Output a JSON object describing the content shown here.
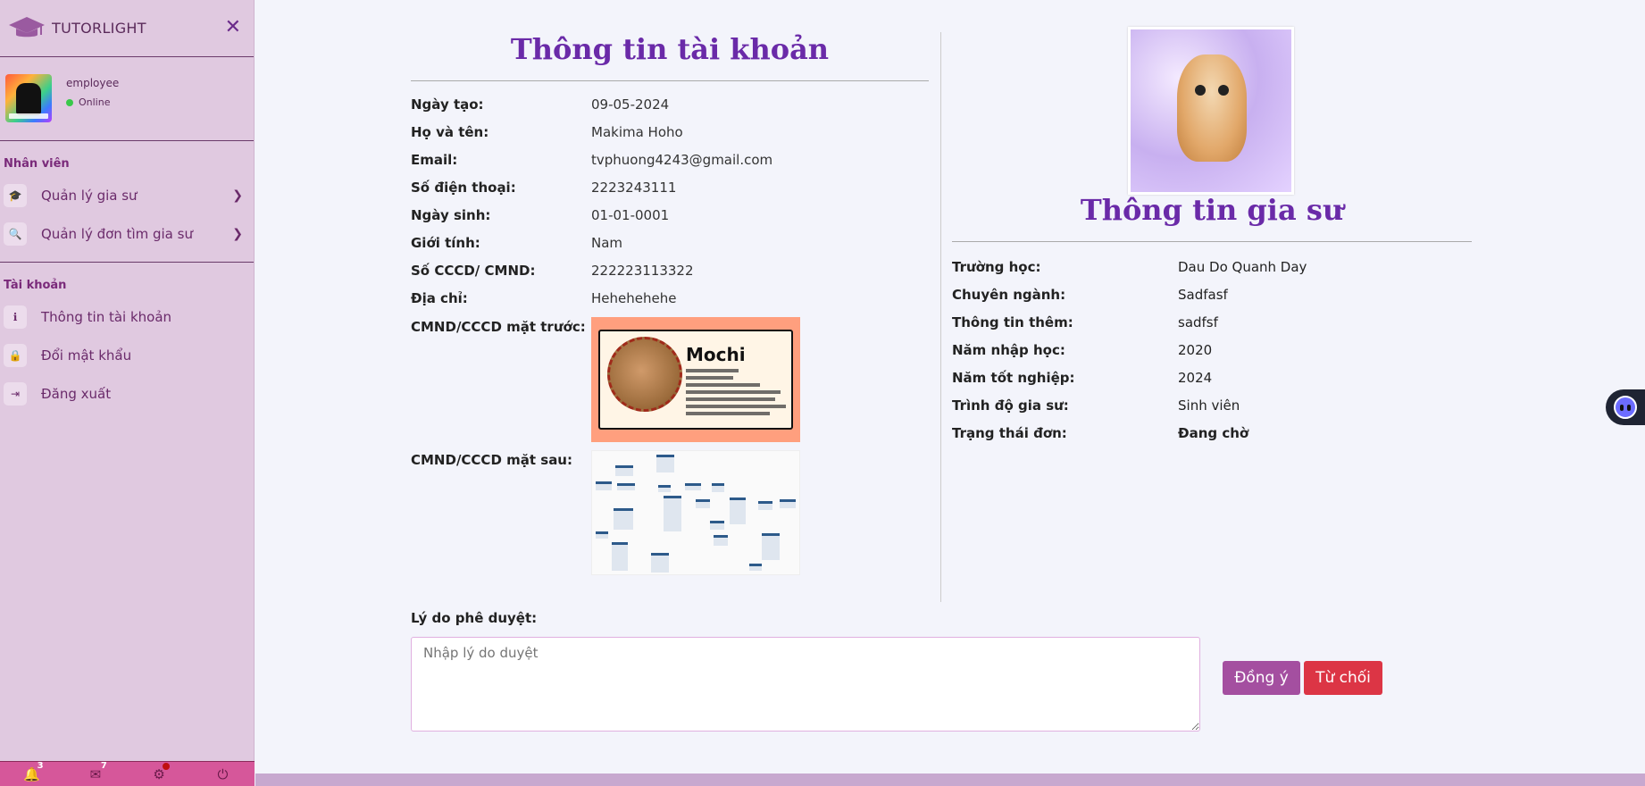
{
  "sidebar": {
    "brand": "TUTORLIGHT",
    "close_icon": "close-icon",
    "user": {
      "name": "employee",
      "status": "Online"
    },
    "sections": [
      {
        "title": "Nhân viên",
        "items": [
          {
            "label": "Quản lý gia sư",
            "icon": "graduation-cap-icon",
            "has_chevron": true
          },
          {
            "label": "Quản lý đơn tìm gia sư",
            "icon": "search-icon",
            "has_chevron": true
          }
        ]
      },
      {
        "title": "Tài khoản",
        "items": [
          {
            "label": "Thông tin tài khoản",
            "icon": "info-icon"
          },
          {
            "label": "Đổi mật khẩu",
            "icon": "lock-icon"
          },
          {
            "label": "Đăng xuất",
            "icon": "logout-icon"
          }
        ]
      }
    ],
    "footer": {
      "notifications": "3",
      "messages": "7"
    }
  },
  "account": {
    "title": "Thông tin tài khoản",
    "fields": [
      {
        "label": "Ngày tạo:",
        "value": "09-05-2024"
      },
      {
        "label": "Họ và tên:",
        "value": "Makima Hoho"
      },
      {
        "label": "Email:",
        "value": "tvphuong4243@gmail.com"
      },
      {
        "label": "Số điện thoại:",
        "value": "2223243111"
      },
      {
        "label": "Ngày sinh:",
        "value": "01-01-0001"
      },
      {
        "label": "Giới tính:",
        "value": "Nam"
      },
      {
        "label": "Số CCCD/ CMND:",
        "value": "222223113322"
      },
      {
        "label": "Địa chỉ:",
        "value": "Hehehehehe"
      }
    ],
    "id_front_label": "CMND/CCCD mặt trước:",
    "id_back_label": "CMND/CCCD mặt sau:",
    "id_card_name": "Mochi"
  },
  "tutor": {
    "title": "Thông tin gia sư",
    "fields": [
      {
        "label": "Trường học:",
        "value": "Dau Do Quanh Day"
      },
      {
        "label": "Chuyên ngành:",
        "value": "Sadfasf"
      },
      {
        "label": "Thông tin thêm:",
        "value": "sadfsf"
      },
      {
        "label": "Năm nhập học:",
        "value": "2020"
      },
      {
        "label": "Năm tốt nghiệp:",
        "value": "2024"
      },
      {
        "label": "Trình độ gia sư:",
        "value": "Sinh viên"
      },
      {
        "label": "Trạng thái đơn:",
        "value": "Đang chờ"
      }
    ]
  },
  "approval": {
    "label": "Lý do phê duyệt:",
    "placeholder": "Nhập lý do duyệt",
    "approve_label": "Đồng ý",
    "reject_label": "Từ chối"
  },
  "colors": {
    "sidebar_bg": "#e0c9e0",
    "title": "#6a2aa8",
    "approve_btn": "#a44fa0",
    "reject_btn": "#dc3545",
    "footer_bg": "#d6579a"
  }
}
